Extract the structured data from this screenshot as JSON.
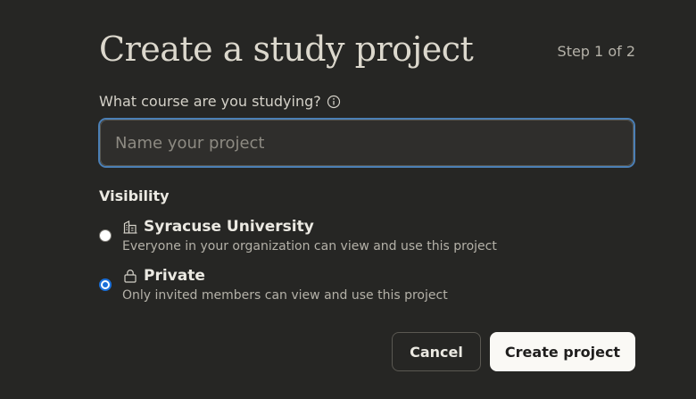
{
  "dialog": {
    "title": "Create a study project",
    "step": "Step 1 of 2"
  },
  "course_field": {
    "label": "What course are you studying?",
    "info_icon": "info-icon",
    "value": "",
    "placeholder": "Name your project"
  },
  "visibility": {
    "label": "Visibility",
    "options": [
      {
        "title": "Syracuse University",
        "description": "Everyone in your organization can view and use this project",
        "icon": "building-icon",
        "selected": false
      },
      {
        "title": "Private",
        "description": "Only invited members can view and use this project",
        "icon": "lock-icon",
        "selected": true
      }
    ]
  },
  "actions": {
    "cancel_label": "Cancel",
    "create_label": "Create project"
  },
  "colors": {
    "background": "#262624",
    "focus_ring": "#4b7fb5",
    "radio_selected": "#1a6fd9",
    "primary_button": "#faf9f5"
  }
}
